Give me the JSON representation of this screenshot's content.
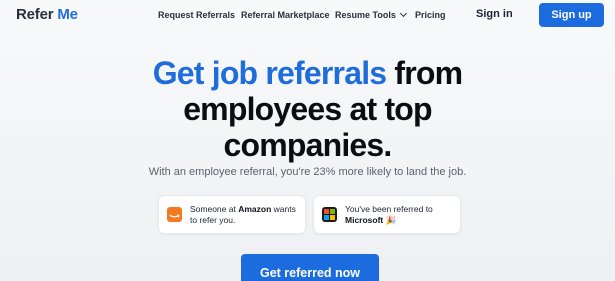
{
  "nav": {
    "logo": {
      "part1": "Refer",
      "part2": "Me"
    },
    "links": [
      {
        "label": "Request Referrals"
      },
      {
        "label": "Referral Marketplace"
      },
      {
        "label": "Resume Tools"
      },
      {
        "label": "Pricing"
      }
    ],
    "sign_in": "Sign in",
    "sign_up": "Sign up"
  },
  "hero": {
    "headline_accent": "Get job referrals",
    "headline_line1_rest": " from",
    "headline_line2": "employees at top",
    "headline_line3": "companies.",
    "subtitle": "With an employee referral, you're 23% more likely to land the job."
  },
  "cards": [
    {
      "icon": "amazon-logo-icon",
      "prefix": "Someone at ",
      "company": "Amazon",
      "suffix": " wants to refer you."
    },
    {
      "icon": "microsoft-logo-icon",
      "prefix": "You've been referred to ",
      "company": "Microsoft",
      "suffix": " 🎉"
    }
  ],
  "cta": {
    "label": "Get referred now"
  },
  "colors": {
    "brand_blue": "#1f6ddb",
    "button_blue": "#1c6ce0",
    "amazon_orange": "#f47a20",
    "ms_red": "#f25022",
    "ms_green": "#7fba00",
    "ms_blue": "#00a4ef",
    "ms_yellow": "#ffb900"
  }
}
